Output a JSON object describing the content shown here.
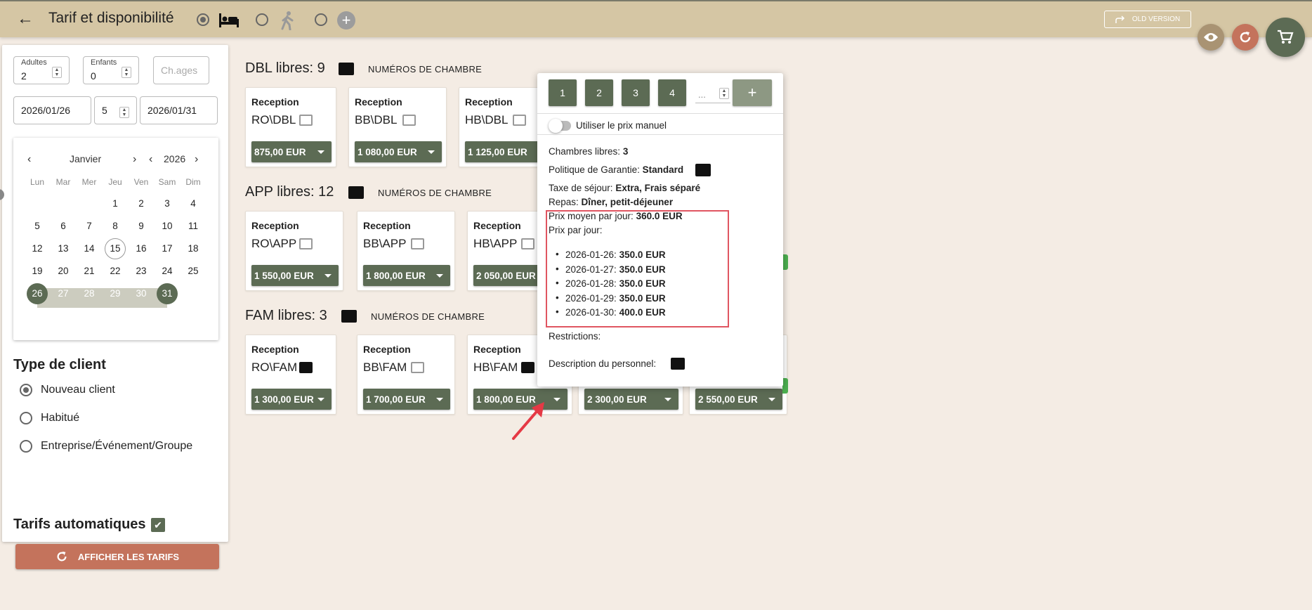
{
  "header": {
    "title": "Tarif et disponibilité",
    "old_version_label": "OLD VERSION",
    "icons": [
      "back-arrow-icon",
      "bed-icon",
      "walking-person-icon",
      "add-circle-icon",
      "share-arrow-icon",
      "eye-icon",
      "refresh-icon",
      "cart-icon"
    ]
  },
  "colors": {
    "accent": "#5c6b54",
    "header": "#d5c6a4",
    "action": "#c4735c",
    "highlight": "#e05561",
    "background": "#f4ece4"
  },
  "sidebar": {
    "adults_label": "Adultes",
    "adults_value": "2",
    "children_label": "Enfants",
    "children_value": "0",
    "ages_placeholder": "Ch.ages",
    "date_from": "2026/01/26",
    "nights": "5",
    "date_to": "2026/01/31",
    "calendar": {
      "month": "Janvier",
      "year": "2026",
      "weekdays": [
        "Lun",
        "Mar",
        "Mer",
        "Jeu",
        "Ven",
        "Sam",
        "Dim"
      ],
      "days": [
        "1",
        "2",
        "3",
        "4",
        "5",
        "6",
        "7",
        "8",
        "9",
        "10",
        "11",
        "12",
        "13",
        "14",
        "15",
        "16",
        "17",
        "18",
        "19",
        "20",
        "21",
        "22",
        "23",
        "24",
        "25",
        "26",
        "27",
        "28",
        "29",
        "30",
        "31"
      ],
      "today": "15",
      "range_start": "26",
      "range_end": "31"
    },
    "client_type_title": "Type de client",
    "client_options": [
      "Nouveau client",
      "Habitué",
      "Entreprise/Événement/Groupe"
    ],
    "client_selected": "Nouveau client",
    "auto_rates_label": "Tarifs automatiques",
    "auto_rates_checked": true,
    "show_rates_button": "AFFICHER LES TARIFS"
  },
  "groups": [
    {
      "title": "DBL libres: 9",
      "numbers_label": "NUMÉROS DE CHAMBRE",
      "cards": [
        {
          "channel": "Reception",
          "code": "RO\\DBL",
          "price": "875,00 EUR"
        },
        {
          "channel": "Reception",
          "code": "BB\\DBL",
          "price": "1 080,00 EUR"
        },
        {
          "channel": "Reception",
          "code": "HB\\DBL",
          "price": "1 125,00 EUR"
        }
      ]
    },
    {
      "title": "APP libres: 12",
      "numbers_label": "NUMÉROS DE CHAMBRE",
      "cards": [
        {
          "channel": "Reception",
          "code": "RO\\APP",
          "price": "1 550,00 EUR"
        },
        {
          "channel": "Reception",
          "code": "BB\\APP",
          "price": "1 800,00 EUR"
        },
        {
          "channel": "Reception",
          "code": "HB\\APP",
          "price": "2 050,00 EUR"
        }
      ]
    },
    {
      "title": "FAM libres: 3",
      "numbers_label": "NUMÉROS DE CHAMBRE",
      "cards": [
        {
          "channel": "Reception",
          "code": "RO\\FAM",
          "price": "1 300,00 EUR"
        },
        {
          "channel": "Reception",
          "code": "BB\\FAM",
          "price": "1 700,00 EUR"
        },
        {
          "channel": "Reception",
          "code": "HB\\FAM",
          "price": "1 800,00 EUR"
        },
        {
          "price": "2 300,00 EUR"
        },
        {
          "price": "2 550,00 EUR"
        }
      ]
    }
  ],
  "popup": {
    "qty_buttons": [
      "1",
      "2",
      "3",
      "4"
    ],
    "qty_placeholder": "...",
    "add_label": "+",
    "manual_price_label": "Utiliser le prix manuel",
    "free_rooms_label": "Chambres libres:",
    "free_rooms_value": "3",
    "guarantee_label": "Politique de Garantie:",
    "guarantee_value": "Standard",
    "tax_label": "Taxe de séjour:",
    "tax_value": "Extra, Frais séparé",
    "meals_label": "Repas:",
    "meals_value": "Dîner, petit-déjeuner",
    "avg_price_label": "Prix moyen par jour:",
    "avg_price_value": "360.0 EUR",
    "per_day_label": "Prix par jour:",
    "per_day": [
      {
        "date": "2026-01-26:",
        "price": "350.0 EUR"
      },
      {
        "date": "2026-01-27:",
        "price": "350.0 EUR"
      },
      {
        "date": "2026-01-28:",
        "price": "350.0 EUR"
      },
      {
        "date": "2026-01-29:",
        "price": "350.0 EUR"
      },
      {
        "date": "2026-01-30:",
        "price": "400.0 EUR"
      }
    ],
    "restrictions_label": "Restrictions:",
    "staff_desc_label": "Description du personnel:"
  }
}
